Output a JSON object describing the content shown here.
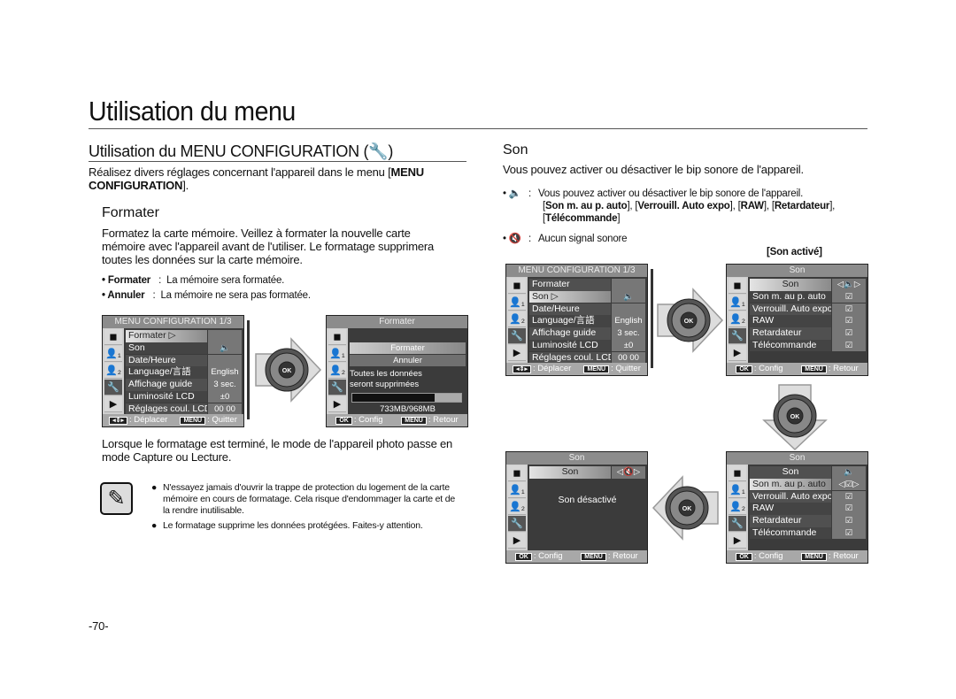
{
  "page": {
    "title": "Utilisation du menu",
    "page_number": "-70-"
  },
  "left": {
    "heading": "Utilisation du MENU CONFIGURATION (",
    "heading_end": ")",
    "intro": "Réalisez divers réglages concernant l'appareil dans le menu [",
    "intro_bold": "MENU CONFIGURATION",
    "intro_end": "].",
    "formater": {
      "heading": "Formater",
      "text": "Formatez la carte mémoire. Veillez à formater la nouvelle carte mémoire avec l'appareil avant de l'utiliser. Le formatage supprimera toutes les données sur la carte mémoire.",
      "options": [
        {
          "label": "• Formater",
          "sep": ":",
          "desc": "La mémoire sera formatée."
        },
        {
          "label": "• Annuler",
          "sep": ":",
          "desc": "La mémoire ne sera pas formatée."
        }
      ],
      "after": "Lorsque le formatage est terminé, le mode de l'appareil photo passe en mode Capture ou Lecture.",
      "notes": [
        "N'essayez jamais d'ouvrir la trappe de protection du logement de la carte mémoire en cours de formatage. Cela risque d'endommager la carte et de la rendre inutilisable.",
        "Le formatage supprime les données protégées. Faites-y attention."
      ]
    }
  },
  "right": {
    "heading": "Son",
    "intro": "Vous pouvez activer ou désactiver le bip sonore de l'appareil.",
    "bullet_on": {
      "sep": ":",
      "desc": "Vous pouvez activer ou désactiver le bip sonore de l'appareil.",
      "items": [
        "Son m. au p. auto",
        "Verrouill. Auto expo",
        "RAW",
        "Retardateur",
        "Télécommande"
      ]
    },
    "bullet_off": {
      "sep": ":",
      "desc": "Aucun signal sonore"
    },
    "caption": "[Son activé]"
  },
  "screens": [
    {
      "id": "menu-config-formater",
      "title": "MENU CONFIGURATION 1/3",
      "rows": [
        {
          "l": "Formater ▷",
          "v": "",
          "sel": true
        },
        {
          "l": "Son",
          "v": "🔈"
        },
        {
          "l": "Date/Heure",
          "v": ""
        },
        {
          "l": "Language/言語",
          "v": "English"
        },
        {
          "l": "Affichage guide",
          "v": "3 sec."
        },
        {
          "l": "Luminosité LCD",
          "v": "±0"
        },
        {
          "l": "Réglages coul. LCD",
          "v": "00 00"
        }
      ],
      "footer": [
        {
          "k": "◂⇕▸",
          "t": ": Déplacer"
        },
        {
          "k": "MENU",
          "t": ": Quitter"
        }
      ]
    },
    {
      "id": "formater-confirm",
      "title": "Formater",
      "rows": [],
      "choices": [
        "Formater",
        "Annuler"
      ],
      "text": [
        "Toutes les données",
        "seront supprimées"
      ],
      "memory": "733MB/968MB",
      "memory_used": 0.76,
      "footer": [
        {
          "k": "OK",
          "t": ": Config"
        },
        {
          "k": "MENU",
          "t": ": Retour"
        }
      ]
    },
    {
      "id": "menu-config-son",
      "title": "MENU CONFIGURATION 1/3",
      "rows": [
        {
          "l": "Formater",
          "v": ""
        },
        {
          "l": "Son ▷",
          "v": "🔈",
          "sel": true
        },
        {
          "l": "Date/Heure",
          "v": ""
        },
        {
          "l": "Language/言語",
          "v": "English"
        },
        {
          "l": "Affichage guide",
          "v": "3 sec."
        },
        {
          "l": "Luminosité LCD",
          "v": "±0"
        },
        {
          "l": "Réglages coul. LCD",
          "v": "00 00"
        }
      ],
      "footer": [
        {
          "k": "◂⇕▸",
          "t": ": Déplacer"
        },
        {
          "k": "MENU",
          "t": ": Quitter"
        }
      ]
    },
    {
      "id": "son-on",
      "title": "Son",
      "rows": [
        {
          "l": "Son",
          "v": "◁🔈▷",
          "sel": true,
          "c": true
        },
        {
          "l": "Son m. au p. auto",
          "v": "☑"
        },
        {
          "l": "Verrouill. Auto expo",
          "v": "☑"
        },
        {
          "l": "RAW",
          "v": "☑"
        },
        {
          "l": "Retardateur",
          "v": "☑"
        },
        {
          "l": "Télécommande",
          "v": "☑"
        }
      ],
      "footer": [
        {
          "k": "OK",
          "t": ": Config"
        },
        {
          "k": "MENU",
          "t": ": Retour"
        }
      ]
    },
    {
      "id": "son-off",
      "title": "Son",
      "rows": [
        {
          "l": "Son",
          "v": "◁🔇▷",
          "sel": true,
          "c": true
        }
      ],
      "text": [
        "Son désactivé"
      ],
      "footer": [
        {
          "k": "OK",
          "t": ": Config"
        },
        {
          "k": "MENU",
          "t": ": Retour"
        }
      ]
    },
    {
      "id": "son-sub",
      "title": "Son",
      "rows": [
        {
          "l": "Son",
          "v": "🔈",
          "c": true
        },
        {
          "l": "Son m. au p. auto",
          "v": "◁☑▷",
          "sel": true
        },
        {
          "l": "Verrouill. Auto expo",
          "v": "☑"
        },
        {
          "l": "RAW",
          "v": "☑"
        },
        {
          "l": "Retardateur",
          "v": "☑"
        },
        {
          "l": "Télécommande",
          "v": "☑"
        }
      ],
      "footer": [
        {
          "k": "OK",
          "t": ": Config"
        },
        {
          "k": "MENU",
          "t": ": Retour"
        }
      ]
    }
  ],
  "dial": {
    "ok_label": "OK"
  },
  "side_icons": [
    "camera-icon",
    "user-1-icon",
    "user-2-icon",
    "wrench-icon",
    "play-icon"
  ]
}
